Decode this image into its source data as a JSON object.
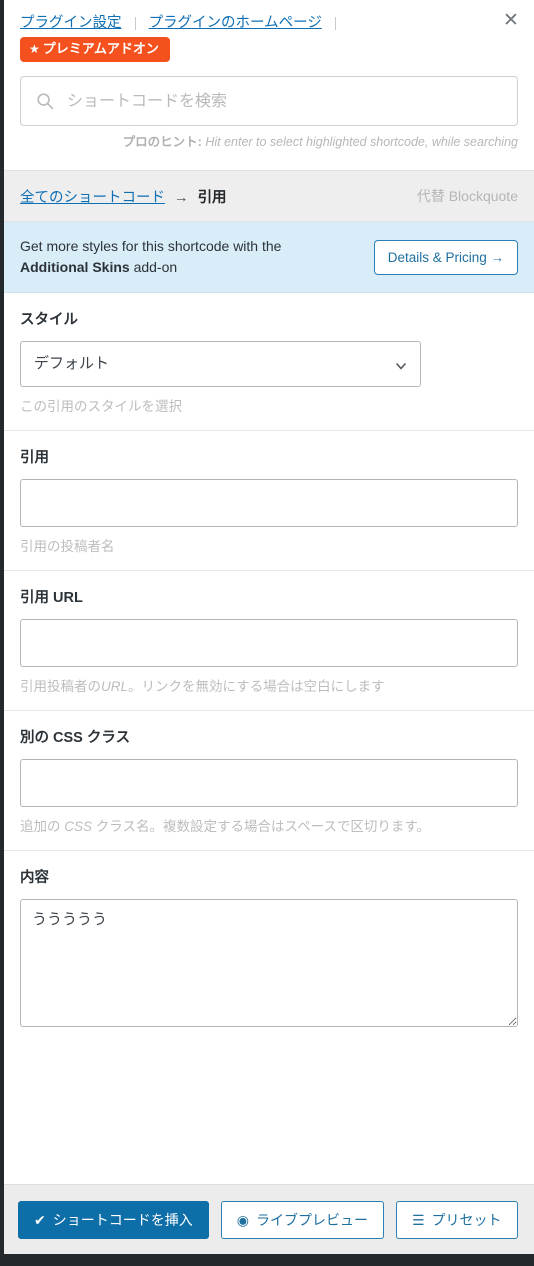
{
  "header": {
    "links": [
      {
        "label": "プラグイン設定",
        "name": "plugin-settings-link"
      },
      {
        "label": "プラグインのホームページ",
        "name": "plugin-homepage-link"
      }
    ],
    "premium_badge": {
      "star": "★",
      "label": "プレミアムアドオン"
    },
    "close_label": "✕"
  },
  "search": {
    "placeholder": "ショートコードを検索",
    "value": "",
    "icon": "search-icon",
    "protip_label": "プロのヒント:",
    "protip_text": "Hit enter to select highlighted shortcode, while searching"
  },
  "breadcrumb": {
    "root_label": "全てのショートコード",
    "arrow": "→",
    "current_label": "引用",
    "alt_label": "代替 Blockquote"
  },
  "notice": {
    "line1": "Get more styles for this shortcode with the",
    "bold": "Additional Skins",
    "line2_tail": " add-on",
    "button_label": "Details & Pricing →"
  },
  "fields": {
    "style": {
      "label": "スタイル",
      "value": "デフォルト",
      "help": "この引用のスタイルを選択",
      "options": [
        "デフォルト"
      ]
    },
    "quote": {
      "label": "引用",
      "value": "",
      "placeholder": "",
      "help": "引用の投稿者名"
    },
    "quote_url": {
      "label": "引用 URL",
      "value": "",
      "placeholder": "",
      "help_pre": "引用投稿者の",
      "help_em": "URL",
      "help_post": "。リンクを無効にする場合は空白にします"
    },
    "css_class": {
      "label": "別の CSS クラス",
      "value": "",
      "placeholder": "",
      "help_pre": "追加の ",
      "help_em": "CSS",
      "help_post": " クラス名。複数設定する場合はスペースで区切ります。"
    },
    "content": {
      "label": "内容",
      "value": "ううううう",
      "placeholder": ""
    }
  },
  "footer": {
    "insert": {
      "icon": "✔",
      "label": "ショートコードを挿入"
    },
    "preview": {
      "icon": "◉",
      "label": "ライブプレビュー"
    },
    "presets": {
      "icon": "☰",
      "label": "プリセット"
    }
  },
  "colors": {
    "primary": "#0e6ea8",
    "link": "#0f6fb4",
    "premium_orange": "#f4511e",
    "notice_bg": "#d9edf9",
    "bar_bg": "#eeeeee",
    "admin_dark": "#23282d"
  }
}
